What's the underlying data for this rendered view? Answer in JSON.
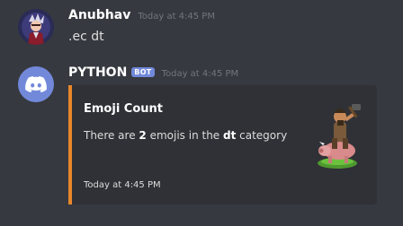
{
  "messages": [
    {
      "username": "Anubhav",
      "timestamp": "Today at 4:45 PM",
      "content": ".ec dt",
      "avatar_icon": "anime-character-avatar"
    },
    {
      "username": "PYTHON",
      "bot_tag": "BOT",
      "timestamp": "Today at 4:45 PM",
      "avatar_icon": "discord-logo",
      "embed": {
        "title": "Emoji Count",
        "description_prefix": "There are ",
        "count": "2",
        "description_middle": " emojis in the ",
        "category": "dt",
        "description_suffix": " category",
        "footer": "Today at 4:45 PM",
        "accent_color": "#e8872b",
        "thumbnail_icon": "hog-rider-emoji"
      }
    }
  ],
  "colors": {
    "background": "#36393f",
    "embed_background": "#2f3136",
    "bot_tag": "#7289da",
    "timestamp": "#72767d"
  }
}
